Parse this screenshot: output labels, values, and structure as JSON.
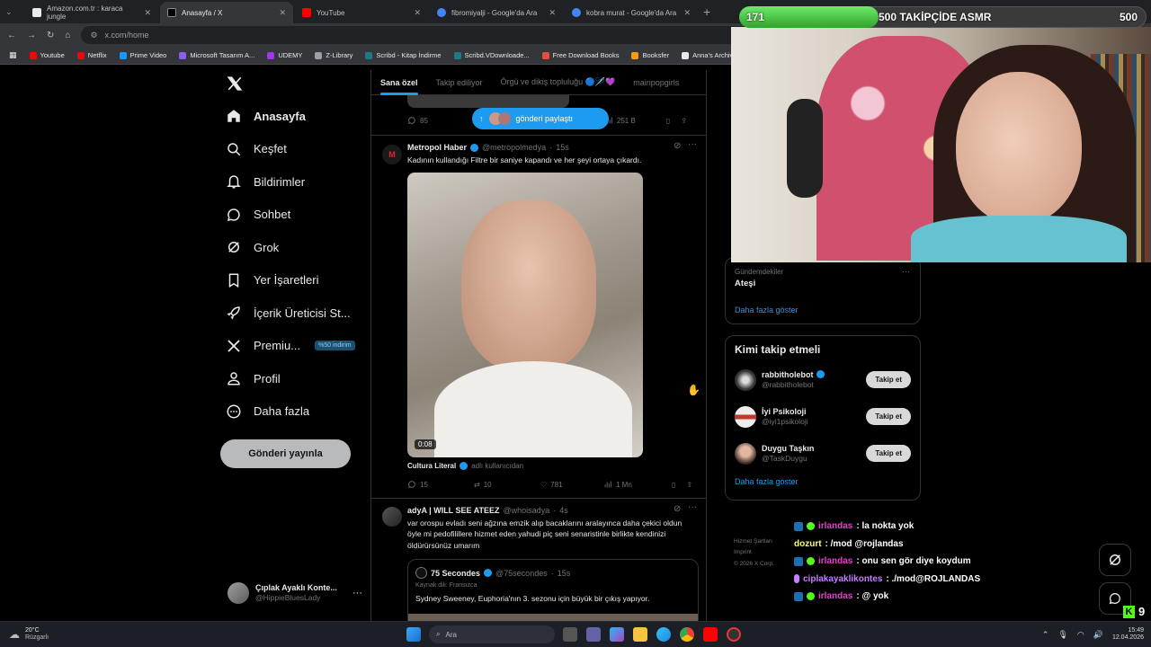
{
  "browser": {
    "tabs": [
      {
        "title": "Amazon.com.tr : karaca jungle",
        "active": false,
        "color": "#e8eaed"
      },
      {
        "title": "Anasayfa / X",
        "active": true,
        "color": "#000000"
      },
      {
        "title": "YouTube",
        "active": false,
        "color": "#ff0000"
      },
      {
        "title": "fibromiyalji - Google'da Ara",
        "active": false,
        "color": "#4285f4"
      },
      {
        "title": "kobra murat - Google'da Ara",
        "active": false,
        "color": "#4285f4"
      }
    ],
    "url": "x.com/home",
    "bookmarks": [
      {
        "label": "Youtube",
        "color": "#ff0000"
      },
      {
        "label": "Netflix",
        "color": "#e50914"
      },
      {
        "label": "Prime Video",
        "color": "#1399ff"
      },
      {
        "label": "Microsoft Tasarım A...",
        "color": "#8a5cf6"
      },
      {
        "label": "UDEMY",
        "color": "#a435f0"
      },
      {
        "label": "Z-Library",
        "color": "#9aa0a6"
      },
      {
        "label": "Scribd - Kitap İndirme",
        "color": "#1e7b85"
      },
      {
        "label": "Scribd.VDownloade...",
        "color": "#1e7b85"
      },
      {
        "label": "Free Download Books",
        "color": "#e74c3c"
      },
      {
        "label": "Booksfer",
        "color": "#f39c12"
      },
      {
        "label": "Anna's Archive",
        "color": "#e8eaed"
      }
    ]
  },
  "nav": {
    "items": [
      {
        "label": "Anasayfa",
        "icon": "home-icon",
        "bold": true
      },
      {
        "label": "Keşfet",
        "icon": "search-icon"
      },
      {
        "label": "Bildirimler",
        "icon": "bell-icon"
      },
      {
        "label": "Sohbet",
        "icon": "chat-icon"
      },
      {
        "label": "Grok",
        "icon": "grok-icon"
      },
      {
        "label": "Yer İşaretleri",
        "icon": "bookmark-icon"
      },
      {
        "label": "İçerik Üreticisi St...",
        "icon": "rocket-icon"
      },
      {
        "label": "Premiu...",
        "icon": "x-logo-icon",
        "badge": "%50 indirim"
      },
      {
        "label": "Profil",
        "icon": "person-icon"
      },
      {
        "label": "Daha fazla",
        "icon": "more-circle-icon"
      }
    ],
    "post_button": "Gönderi yayınla",
    "account_name": "Çıplak Ayaklı Konte...",
    "account_handle": "@HippieBluesLady"
  },
  "feed": {
    "tabs": [
      "Sana özel",
      "Takip ediliyor",
      "Örgü ve dikiş topluluğu 🔵🪡💜",
      "mainpopgirls"
    ],
    "toast": "gönderi paylaştı",
    "prev_post_stats": {
      "replies": "85",
      "views": "251 B"
    },
    "post1": {
      "name": "Metropol Haber",
      "handle": "@metropolmedya",
      "time": "15s",
      "text": "Kadının kullandığı Filtre bir saniye kapandı ve her şeyi ortaya çıkardı.",
      "video_time": "0:08",
      "source_name": "Cultura Literal",
      "source_suffix": "adlı kullanıcıdan",
      "replies": "15",
      "retweets": "10",
      "likes": "781",
      "views": "1 Mn"
    },
    "post2": {
      "name": "adyA | WILL SEE ATEEZ",
      "handle": "@whoisadya",
      "time": "4s",
      "text": "var orospu evladı seni ağzına emzik alıp bacaklarını aralayınca daha çekici oldun öyle mi pedofilillere hizmet eden yahudi piç seni senaristinle birlikte kendinizi öldürürsünüz umarım",
      "quote_name": "75 Secondes",
      "quote_handle": "@75secondes",
      "quote_time": "15s",
      "quote_lang": "Kaynak dili: Fransızca",
      "quote_text": "Sydney Sweeney, Euphoria'nın 3. sezonu için büyük bir çıkış yapıyor."
    }
  },
  "stream": {
    "follower_count": "171",
    "goal_text": "500 TAKİPÇİDE ASMR",
    "goal_target": "500",
    "goal_progress": 0.342
  },
  "sidebar": {
    "trend_category": "Gündemdekiler",
    "trend_name": "Ateşi",
    "show_more": "Daha fazla göster",
    "who_to_follow_title": "Kimi takip etmeli",
    "follow_label": "Takip et",
    "suggestions": [
      {
        "name": "rabbitholebot",
        "handle": "@rabbitholebot",
        "verified": true
      },
      {
        "name": "İyi Psikoloji",
        "handle": "@iyi1psikoloji",
        "verified": false
      },
      {
        "name": "Duygu Taşkın",
        "handle": "@TaskDuygu",
        "verified": false
      }
    ],
    "show_more_2": "Daha fazla göster",
    "footer1": "Hizmet Şartları",
    "footer2": "Imprint",
    "footer3": "© 2026 X Corp."
  },
  "chat": [
    {
      "user": "irlandas",
      "msg": ": la nokta yok",
      "color": "#e83fd1"
    },
    {
      "user": "dozurt",
      "msg": ": /mod @rojlandas",
      "color": "#ffff66",
      "mention": "@rojlandas"
    },
    {
      "user": "irlandas",
      "msg": ": onu sen gör diye koydum",
      "color": "#e83fd1"
    },
    {
      "user": "ciplakayaklikontes",
      "msg": ": ./mod@ROJLANDAS",
      "color": "#c77dff"
    },
    {
      "user": "irlandas",
      "msg": ": @ yok",
      "color": "#e83fd1"
    }
  ],
  "kick_count": "9",
  "taskbar": {
    "weather_temp": "20°C",
    "weather_text": "Rüzgarlı",
    "search": "Ara",
    "time": "15:49",
    "date": "12.04.2026"
  }
}
